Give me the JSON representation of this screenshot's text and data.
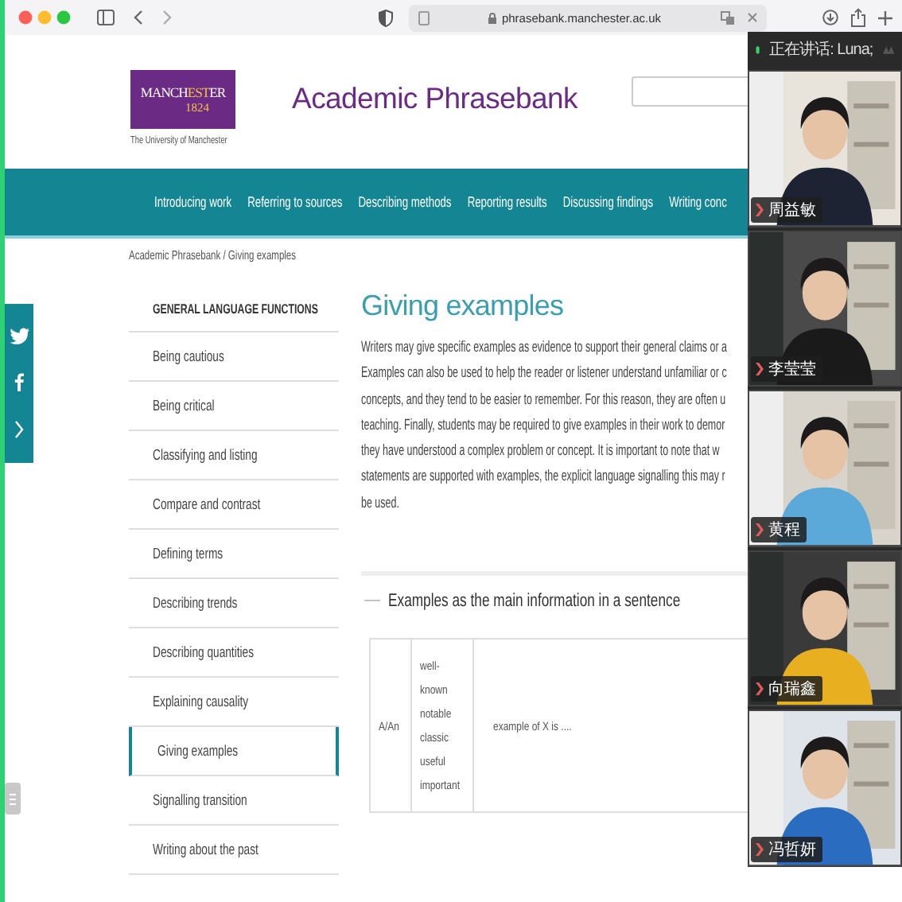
{
  "browser": {
    "url": "phrasebank.manchester.ac.uk"
  },
  "header": {
    "logo_parts": [
      {
        "text": "MANCH",
        "accent": false
      },
      {
        "text": "EST",
        "accent": true
      },
      {
        "text": "ER",
        "accent": false
      }
    ],
    "logo_year": "1824",
    "logo_caption": "The University of Manchester",
    "site_title": "Academic Phrasebank"
  },
  "nav": {
    "items": [
      "Introducing work",
      "Referring to sources",
      "Describing methods",
      "Reporting results",
      "Discussing findings",
      "Writing conc"
    ]
  },
  "breadcrumb": "Academic Phrasebank / Giving examples",
  "sidebar": {
    "heading": "GENERAL LANGUAGE FUNCTIONS",
    "items": [
      {
        "label": "Being cautious",
        "selected": false
      },
      {
        "label": "Being critical",
        "selected": false
      },
      {
        "label": "Classifying and listing",
        "selected": false
      },
      {
        "label": "Compare and contrast",
        "selected": false
      },
      {
        "label": "Defining terms",
        "selected": false
      },
      {
        "label": "Describing trends",
        "selected": false
      },
      {
        "label": "Describing quantities",
        "selected": false
      },
      {
        "label": "Explaining causality",
        "selected": false
      },
      {
        "label": "Giving examples",
        "selected": true
      },
      {
        "label": "Signalling transition",
        "selected": false
      },
      {
        "label": "Writing about the past",
        "selected": false
      }
    ]
  },
  "content": {
    "title": "Giving examples",
    "paragraph_lines": [
      "Writers may give specific examples as evidence to support their general claims or a",
      "Examples can also be used to help the reader or listener understand unfamiliar or c",
      "concepts, and they tend to be easier to remember. For this reason, they are often u",
      "teaching. Finally, students may be required to give examples in their work to demor",
      "they have understood a complex problem or concept. It is important to note that w",
      "statements are supported with examples, the explicit language signalling this may r",
      "be used."
    ],
    "section": {
      "toggle": "—",
      "heading": "Examples as the main information in a sentence",
      "rows": [
        {
          "cells": [
            [
              "A/An"
            ],
            [
              "well-",
              "known",
              "notable",
              "classic",
              "useful",
              "important"
            ],
            [
              "example of X is ...."
            ]
          ]
        }
      ]
    }
  },
  "video_panel": {
    "speaking_label": "正在讲话: Luna;",
    "participants": [
      {
        "name": "周益敏"
      },
      {
        "name": "李莹莹"
      },
      {
        "name": "黄程"
      },
      {
        "name": "向瑞鑫"
      },
      {
        "name": "冯哲妍"
      }
    ]
  }
}
